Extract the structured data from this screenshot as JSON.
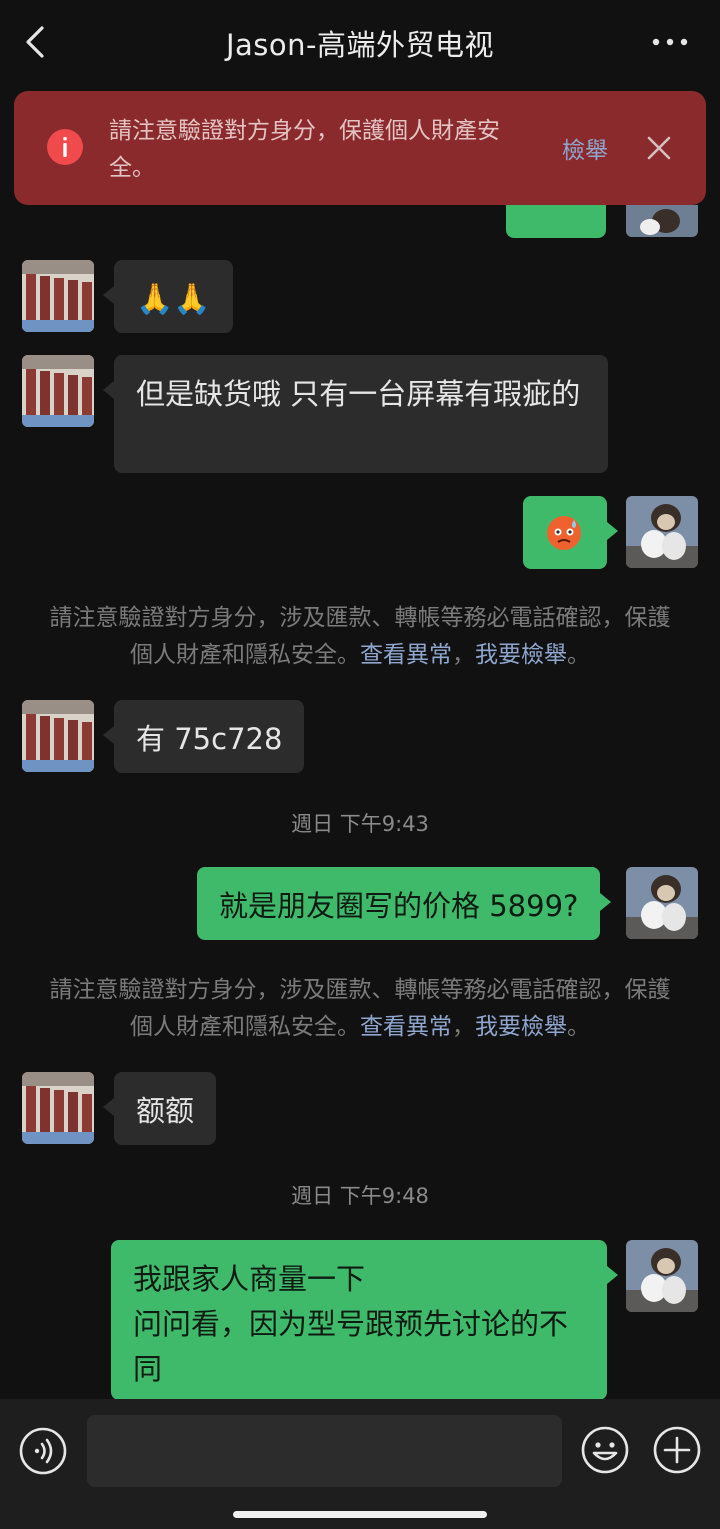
{
  "header": {
    "title": "Jason-高端外贸电视"
  },
  "warning_banner": {
    "text": "請注意驗證對方身分，保護個人財產安全。",
    "report_label": "檢舉"
  },
  "messages": {
    "emoji_prayer": "🙏🙏",
    "stock_msg": "但是缺货哦  只有一台屏幕有瑕疵的",
    "has_msg": "有 75c728",
    "price_msg": "就是朋友圈写的价格 5899?",
    "eh_msg": "额额",
    "family_line1": "我跟家人商量一下",
    "family_line2": "问问看，因为型号跟预先讨论的不同"
  },
  "system_notice": {
    "text": "請注意驗證對方身分，涉及匯款、轉帳等務必電話確認，保護個人財產和隱私安全。",
    "view_abnormal": "查看異常",
    "separator": "，",
    "report": "我要檢舉",
    "period": "。"
  },
  "timestamps": {
    "t1": "週日 下午9:43",
    "t2": "週日 下午9:48"
  },
  "colors": {
    "background": "#111111",
    "banner_red": "#8a2a2c",
    "bubble_out": "#3fba6b",
    "bubble_in": "#2c2c2c",
    "link": "#8fa6cf"
  }
}
